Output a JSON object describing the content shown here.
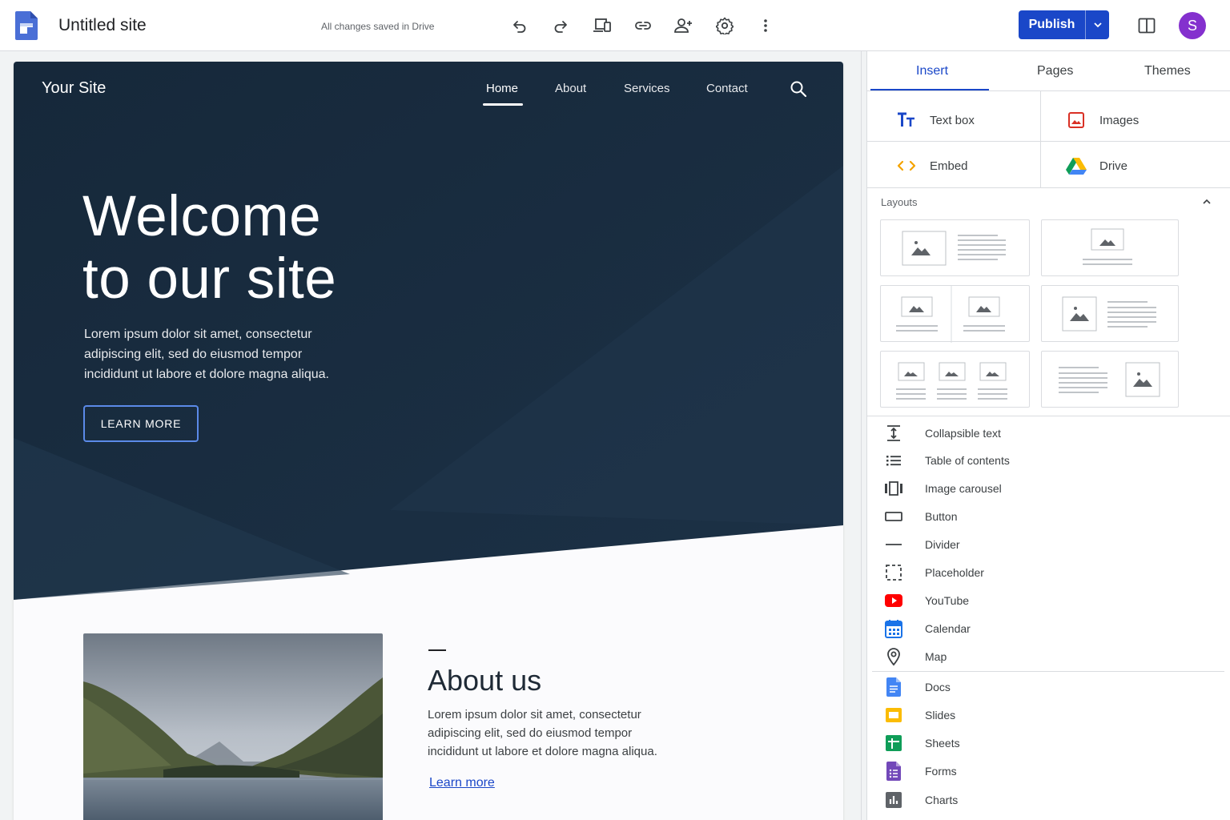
{
  "app": {
    "title": "Untitled site",
    "save_status": "All changes saved in Drive",
    "publish_label": "Publish",
    "avatar_initial": "S",
    "accent_color": "#1a47c8"
  },
  "toolbar_icons": [
    "undo-icon",
    "redo-icon",
    "preview-devices-icon",
    "link-icon",
    "share-icon",
    "settings-icon",
    "more-vert-icon"
  ],
  "site": {
    "name": "Your Site",
    "nav": [
      "Home",
      "About",
      "Services",
      "Contact"
    ],
    "active_nav": "Home",
    "hero_title_line1": "Welcome",
    "hero_title_line2": "to our site",
    "hero_body": "Lorem ipsum dolor sit amet, consectetur adipiscing elit, sed do eiusmod tempor incididunt ut labore et dolore magna aliqua.",
    "hero_button": "LEARN MORE",
    "hero_color": "#1a2a3a",
    "about_title": "About us",
    "about_body": "Lorem ipsum dolor sit amet, consectetur adipiscing elit, sed do eiusmod tempor incididunt ut labore et dolore magna aliqua.",
    "about_link": "Learn more"
  },
  "panel": {
    "tabs": [
      "Insert",
      "Pages",
      "Themes"
    ],
    "active_tab": "Insert",
    "insert_items": [
      "Text box",
      "Images",
      "Embed",
      "Drive"
    ],
    "layouts_label": "Layouts",
    "components": [
      "Collapsible text",
      "Table of contents",
      "Image carousel",
      "Button",
      "Divider",
      "Placeholder",
      "YouTube",
      "Calendar",
      "Map"
    ],
    "google_apps": [
      "Docs",
      "Slides",
      "Sheets",
      "Forms",
      "Charts"
    ]
  }
}
